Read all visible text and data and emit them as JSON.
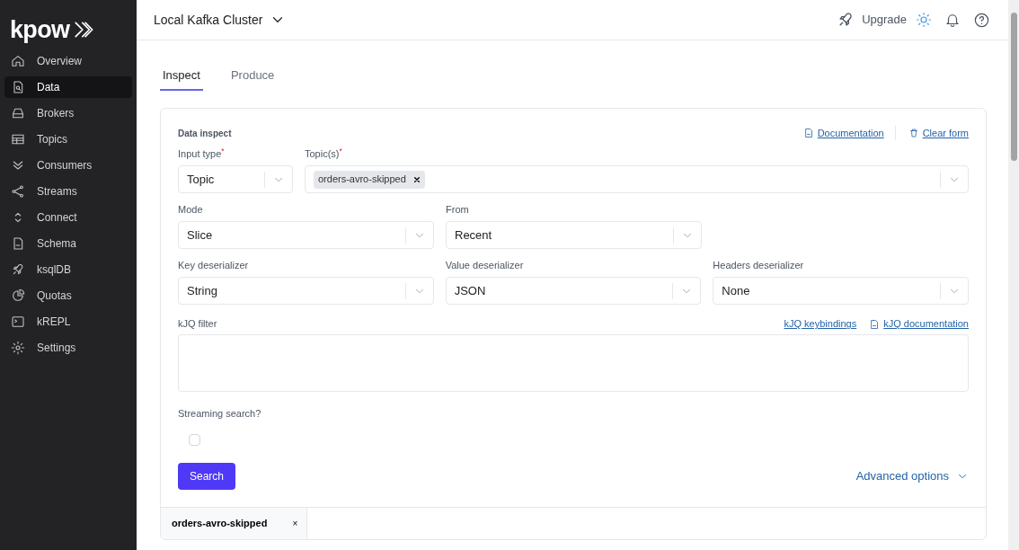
{
  "logo": "kpow",
  "sidebar": {
    "items": [
      {
        "label": "Overview",
        "selected": false
      },
      {
        "label": "Data",
        "selected": true
      },
      {
        "label": "Brokers",
        "selected": false
      },
      {
        "label": "Topics",
        "selected": false
      },
      {
        "label": "Consumers",
        "selected": false
      },
      {
        "label": "Streams",
        "selected": false
      },
      {
        "label": "Connect",
        "selected": false
      },
      {
        "label": "Schema",
        "selected": false
      },
      {
        "label": "ksqlDB",
        "selected": false
      },
      {
        "label": "Quotas",
        "selected": false
      },
      {
        "label": "kREPL",
        "selected": false
      },
      {
        "label": "Settings",
        "selected": false
      }
    ]
  },
  "header": {
    "cluster": "Local Kafka Cluster",
    "upgrade": "Upgrade"
  },
  "tabs": [
    {
      "label": "Inspect",
      "selected": true
    },
    {
      "label": "Produce",
      "selected": false
    }
  ],
  "form": {
    "title": "Data inspect",
    "links": [
      "Documentation",
      "Clear form"
    ],
    "rows": [
      [
        {
          "label": "Input type$^{*}$",
          "kind": "select",
          "value": "Topic"
        },
        {
          "label": "Topic(s)$^{*}$",
          "kind": "multi",
          "tags": [
            "orders-avro-skipped"
          ]
        }
      ],
      [
        {
          "label": "Mode",
          "kind": "select",
          "value": "Slice"
        },
        {
          "label": "From",
          "kind": "select",
          "value": "Recent"
        }
      ],
      [
        {
          "label": "Key deserializer",
          "kind": "select",
          "value": "String"
        },
        {
          "label": "Value deserializer",
          "kind": "select",
          "value": "JSON"
        },
        {
          "label": "Headers deserializer",
          "kind": "select",
          "value": "None"
        }
      ]
    ],
    "filter": {
      "label": "kJQ filter",
      "links": [
        "kJQ keybindings",
        "kJQ documentation"
      ]
    },
    "streaming": {
      "label": "Streaming search?",
      "checked": false
    },
    "search_button": "Search",
    "advanced": "Advanced options"
  },
  "result_tabs": [
    {
      "label": "orders-avro-skipped",
      "close": "×"
    }
  ]
}
